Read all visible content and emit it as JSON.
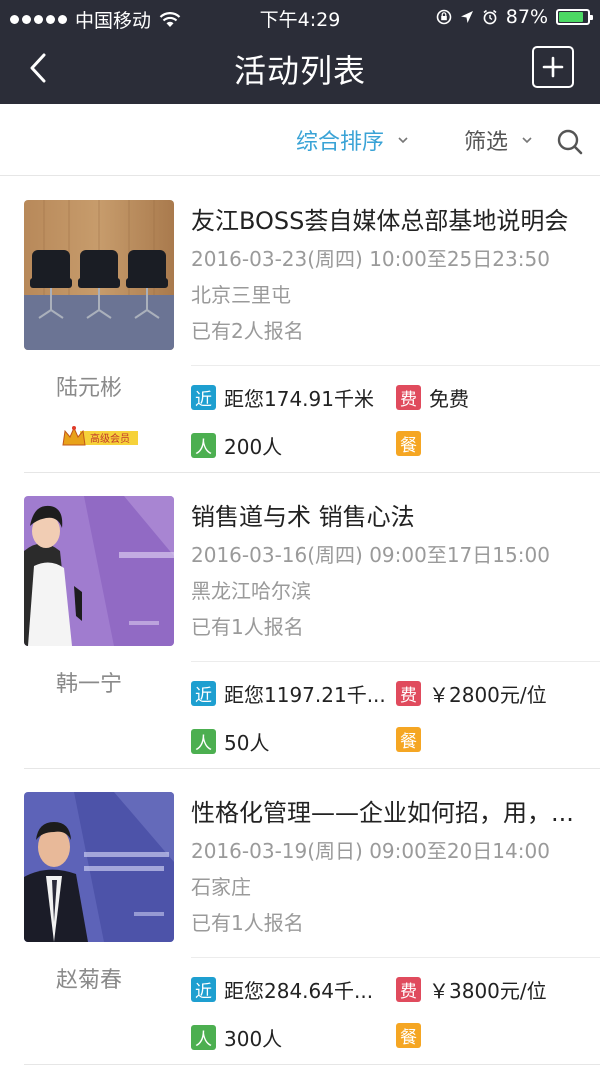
{
  "status_bar": {
    "carrier": "中国移动",
    "time": "下午4:29",
    "battery": "87%",
    "battery_level": 0.87
  },
  "nav": {
    "title": "活动列表",
    "back_icon": "chevron-left-icon",
    "add_icon": "plus-square-icon"
  },
  "filters": {
    "sort_label": "综合排序",
    "filter_label": "筛选",
    "sort_color": "#3aa3d6"
  },
  "tag_labels": {
    "near": "近",
    "fee": "费",
    "people": "人",
    "meal": "餐"
  },
  "member_badge_text": "高级会员",
  "events": [
    {
      "title": "友江BOSS荟自媒体总部基地说明会",
      "time": "2016-03-23(周四) 10:00至25日23:50",
      "location": "北京三里屯",
      "signups": "已有2人报名",
      "organizer": "陆元彬",
      "distance": "距您174.91千米",
      "fee": "免费",
      "capacity": "200人",
      "has_member_badge": true
    },
    {
      "title": "销售道与术 销售心法",
      "time": "2016-03-16(周四) 09:00至17日15:00",
      "location": "黑龙江哈尔滨",
      "signups": "已有1人报名",
      "organizer": "韩一宁",
      "distance": "距您1197.21千...",
      "fee": "￥2800元/位",
      "capacity": "50人",
      "has_member_badge": false
    },
    {
      "title": "性格化管理——企业如何招，用，...",
      "time": "2016-03-19(周日) 09:00至20日14:00",
      "location": "石家庄",
      "signups": "已有1人报名",
      "organizer": "赵菊春",
      "distance": "距您284.64千...",
      "fee": "￥3800元/位",
      "capacity": "300人",
      "has_member_badge": false
    }
  ]
}
